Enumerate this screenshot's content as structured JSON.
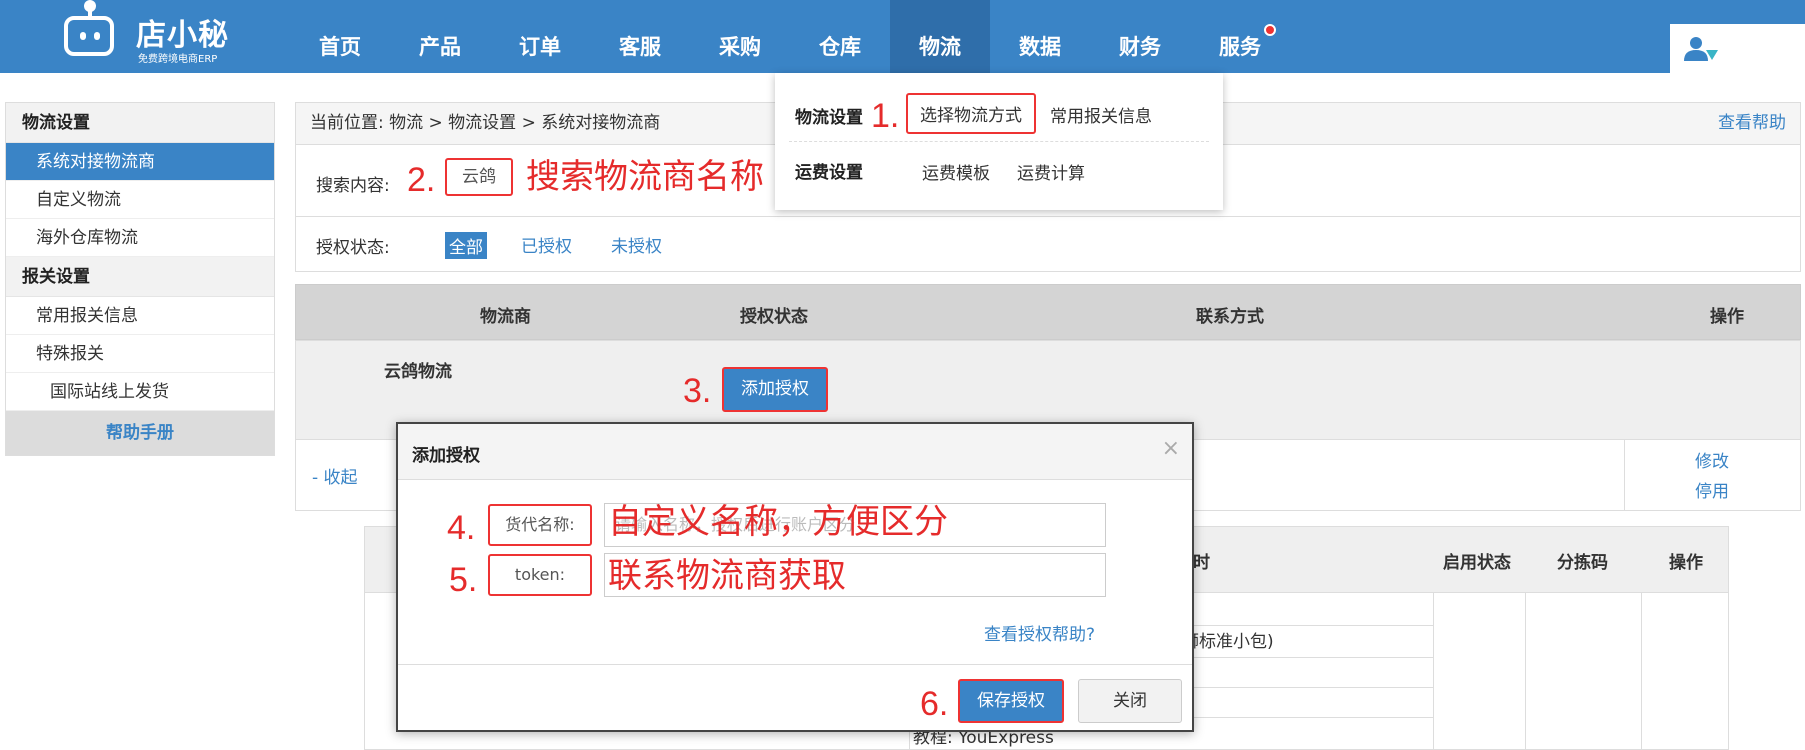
{
  "brand": {
    "name": "店小秘",
    "subtitle": "免费跨境电商ERP"
  },
  "nav": [
    "首页",
    "产品",
    "订单",
    "客服",
    "采购",
    "仓库",
    "物流",
    "数据",
    "财务",
    "服务"
  ],
  "sidebar": {
    "section1": "物流设置",
    "items1": [
      "系统对接物流商",
      "自定义物流",
      "海外仓库物流"
    ],
    "section2": "报关设置",
    "items2": [
      "常用报关信息",
      "特殊报关",
      "国际站线上发货"
    ],
    "help": "帮助手册"
  },
  "breadcrumb": {
    "text": "当前位置:  物流 >  物流设置 > 系统对接物流商",
    "help": "查看帮助"
  },
  "filter": {
    "search_label": "搜索内容:",
    "search_value": "云鸽",
    "auth_label": "授权状态:",
    "auth_options": [
      "全部",
      "已授权",
      "未授权"
    ]
  },
  "grid": {
    "headers": [
      "物流商",
      "授权状态",
      "联系方式",
      "操作"
    ],
    "carrier": "云鸽物流",
    "add_button": "添加授权",
    "collapse": "- 收起",
    "ops": [
      "修改",
      "停用"
    ]
  },
  "sub_table": {
    "headers": [
      "时",
      "启用状态",
      "分拣码",
      "操作"
    ],
    "row_text": "纬狮标准小包)",
    "row_text2": "教程:   YouExpress"
  },
  "dropdown": {
    "group1": "物流设置",
    "group1_links": [
      "选择物流方式",
      "常用报关信息"
    ],
    "group2": "运费设置",
    "group2_links": [
      "运费模板",
      "运费计算"
    ]
  },
  "modal": {
    "title": "添加授权",
    "close": "×",
    "field1_label": "货代名称:",
    "field1_placeholder": "请输入名称，授权后进行账户区分",
    "field2_label": "token:",
    "help": "查看授权帮助?",
    "save": "保存授权",
    "cancel": "关闭"
  },
  "annotations": {
    "n1": "1.",
    "n2": "2.",
    "n3": "3.",
    "n4": "4.",
    "n5": "5.",
    "n6": "6.",
    "t2": "搜索物流商名称",
    "t4": "自定义名称，方便区分",
    "t5": "联系物流商获取"
  },
  "colors": {
    "primary": "#3a84c6",
    "annotation": "#e52b2b"
  }
}
